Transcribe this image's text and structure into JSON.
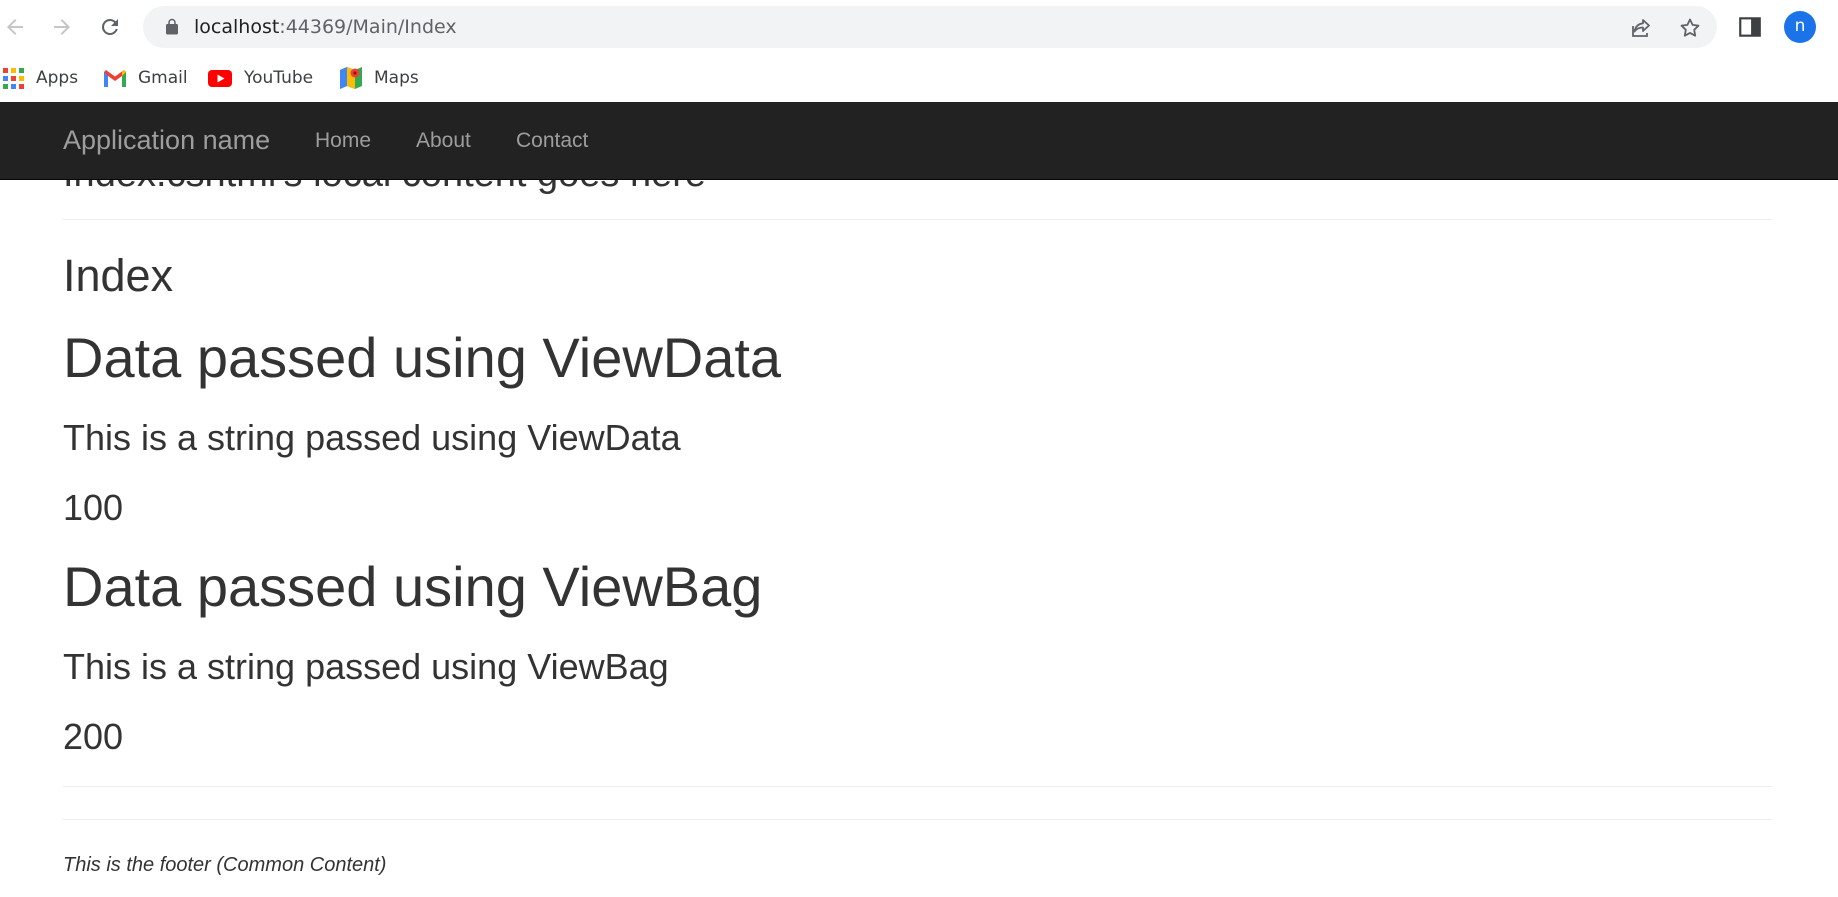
{
  "browser": {
    "url_host": "localhost",
    "url_path": ":44369/Main/Index",
    "profile_initial": "n",
    "bookmarks": [
      {
        "label": "Apps",
        "icon": "apps-grid-icon"
      },
      {
        "label": "Gmail",
        "icon": "gmail-icon"
      },
      {
        "label": "YouTube",
        "icon": "youtube-icon"
      },
      {
        "label": "Maps",
        "icon": "maps-icon"
      }
    ]
  },
  "navbar": {
    "brand": "Application name",
    "links": [
      "Home",
      "About",
      "Contact"
    ]
  },
  "main": {
    "scrolled_heading": "Index.cshtml's local content goes here",
    "index_heading": "Index",
    "viewdata_heading": "Data passed using ViewData",
    "viewdata_string": "This is a string passed using ViewData",
    "viewdata_number": "100",
    "viewbag_heading": "Data passed using ViewBag",
    "viewbag_string": "This is a string passed using ViewBag",
    "viewbag_number": "200"
  },
  "footer": {
    "text": "This is the footer (Common Content)"
  },
  "colors": {
    "navbar_bg": "#222222",
    "navbar_text": "#9d9d9d",
    "body_text": "#333333",
    "omnibox_bg": "#f1f3f4",
    "avatar_bg": "#1a73e8"
  }
}
